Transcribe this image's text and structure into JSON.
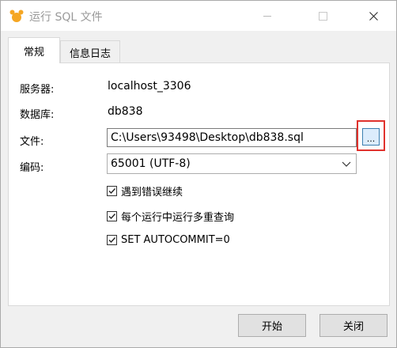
{
  "window": {
    "title": "运行 SQL 文件",
    "minimize_symbol": "—",
    "maximize_symbol": "☐",
    "close_symbol": "✕"
  },
  "tabs": [
    {
      "label": "常规",
      "active": true
    },
    {
      "label": "信息日志",
      "active": false
    }
  ],
  "form": {
    "server_label": "服务器:",
    "server_value": "localhost_3306",
    "database_label": "数据库:",
    "database_value": "db838",
    "file_label": "文件:",
    "file_value": "C:\\Users\\93498\\Desktop\\db838.sql",
    "browse_label": "...",
    "encoding_label": "编码:",
    "encoding_value": "65001 (UTF-8)"
  },
  "options": [
    {
      "label": "遇到错误继续",
      "checked": true
    },
    {
      "label": "每个运行中运行多重查询",
      "checked": true
    },
    {
      "label": "SET AUTOCOMMIT=0",
      "checked": true
    }
  ],
  "buttons": {
    "start": "开始",
    "close": "关闭"
  },
  "colors": {
    "highlight": "#e0322d",
    "browse_border": "#3c7fb1",
    "app_icon": "#f5a623"
  }
}
